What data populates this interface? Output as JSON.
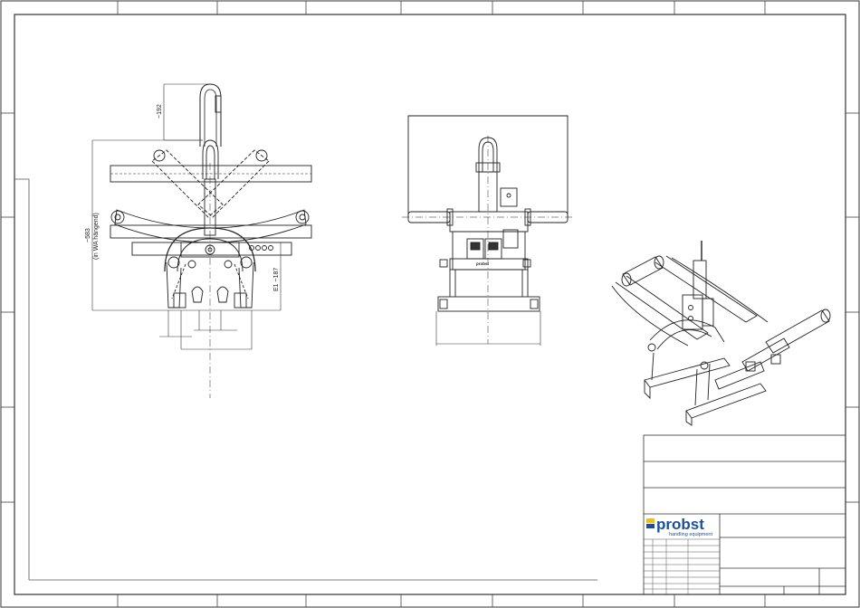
{
  "drawing": {
    "dimensions": {
      "top_height": "~192",
      "overall_height": "~583",
      "overall_height_note": "(in WA hängend)",
      "right_height": "E1 ~187"
    },
    "device_label": "probst"
  },
  "title_block": {
    "logo_text": "probst",
    "logo_tagline": "handling equipment",
    "colors": {
      "logo_blue": "#1b4f9c",
      "logo_yellow": "#f2c200"
    }
  }
}
